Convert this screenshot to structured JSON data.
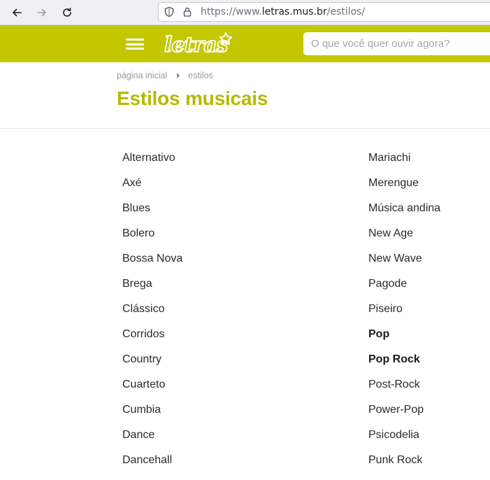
{
  "browser": {
    "url_prefix": "https://www.",
    "url_host": "letras.mus.br",
    "url_path": "/estilos/"
  },
  "header": {
    "logo_text": "letras",
    "search_placeholder": "O que você quer ouvir agora?",
    "brand_color": "#c2c700"
  },
  "breadcrumb": {
    "home": "página inicial",
    "current": "estilos"
  },
  "page": {
    "title": "Estilos musicais"
  },
  "styles": {
    "left": [
      {
        "label": "Alternativo",
        "bold": false
      },
      {
        "label": "Axé",
        "bold": false
      },
      {
        "label": "Blues",
        "bold": false
      },
      {
        "label": "Bolero",
        "bold": false
      },
      {
        "label": "Bossa Nova",
        "bold": false
      },
      {
        "label": "Brega",
        "bold": false
      },
      {
        "label": "Clássico",
        "bold": false
      },
      {
        "label": "Corridos",
        "bold": false
      },
      {
        "label": "Country",
        "bold": false
      },
      {
        "label": "Cuarteto",
        "bold": false
      },
      {
        "label": "Cumbia",
        "bold": false
      },
      {
        "label": "Dance",
        "bold": false
      },
      {
        "label": "Dancehall",
        "bold": false
      }
    ],
    "right": [
      {
        "label": "Mariachi",
        "bold": false
      },
      {
        "label": "Merengue",
        "bold": false
      },
      {
        "label": "Música andina",
        "bold": false
      },
      {
        "label": "New Age",
        "bold": false
      },
      {
        "label": "New Wave",
        "bold": false
      },
      {
        "label": "Pagode",
        "bold": false
      },
      {
        "label": "Piseiro",
        "bold": false
      },
      {
        "label": "Pop",
        "bold": true
      },
      {
        "label": "Pop Rock",
        "bold": true
      },
      {
        "label": "Post-Rock",
        "bold": false
      },
      {
        "label": "Power-Pop",
        "bold": false
      },
      {
        "label": "Psicodelia",
        "bold": false
      },
      {
        "label": "Punk Rock",
        "bold": false
      }
    ]
  }
}
